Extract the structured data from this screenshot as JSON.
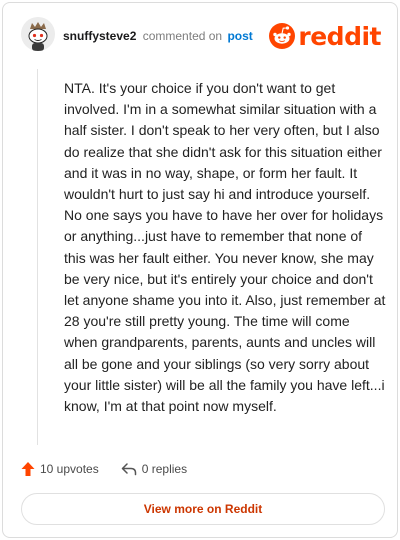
{
  "header": {
    "username": "snuffysteve2",
    "verb": "commented on",
    "post_link": "post",
    "logo_text": "reddit",
    "brand_color": "#ff4500"
  },
  "comment": {
    "text": "NTA. It's your choice if you don't want to get involved. I'm in a somewhat similar situation with a half sister. I don't speak to her very often, but I also do realize that she didn't ask for this situation either and it was in no way, shape, or form her fault. It wouldn't hurt to just say hi and introduce yourself. No one says you have to have her over for holidays or anything...just have to remember that none of this was her fault either. You never know, she may be very nice, but it's entirely your choice and don't let anyone shame you into it. Also, just remember at 28 you're still pretty young. The time will come when grandparents, parents, aunts and uncles will all be gone and your siblings (so very sorry about your little sister) will be all the family you have left...i know, I'm at that point now myself."
  },
  "actions": {
    "upvotes": "10 upvotes",
    "replies": "0 replies"
  },
  "footer": {
    "more_label": "View more on Reddit"
  },
  "icons": {
    "avatar": "snoo-avatar-icon",
    "logo": "reddit-snoo-icon",
    "upvote": "upvote-arrow-icon",
    "reply": "reply-arrow-icon"
  }
}
